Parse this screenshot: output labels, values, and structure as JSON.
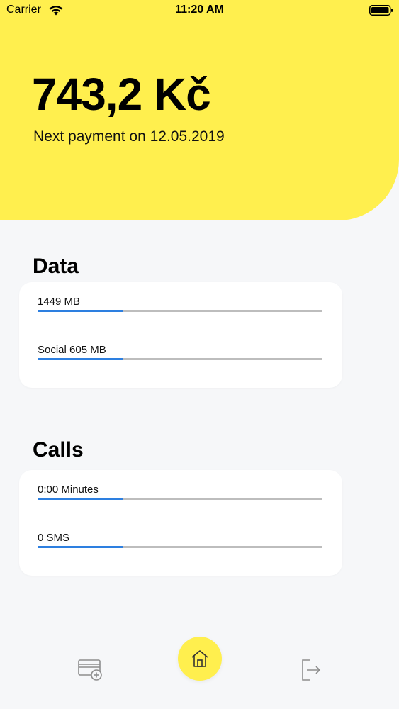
{
  "status_bar": {
    "carrier": "Carrier",
    "time": "11:20 AM"
  },
  "balance": {
    "amount": "743,2 Kč",
    "next_payment": "Next payment on 12.05.2019"
  },
  "sections": {
    "data": {
      "title": "Data",
      "items": [
        {
          "label": "1449 MB",
          "fill_fraction": 0.3
        },
        {
          "label": "Social 605 MB",
          "fill_fraction": 0.3
        }
      ]
    },
    "calls": {
      "title": "Calls",
      "items": [
        {
          "label": "0:00 Minutes",
          "fill_fraction": 0.3
        },
        {
          "label": "0 SMS",
          "fill_fraction": 0.3
        }
      ]
    }
  },
  "tab_bar": {
    "icons": [
      "add-card-icon",
      "home-icon",
      "logout-icon"
    ],
    "active": "home-icon"
  },
  "colors": {
    "accent_yellow": "#ffef4e",
    "progress_blue": "#2d7fe0",
    "track_gray": "#bdbdbd",
    "background": "#f6f7f9"
  }
}
